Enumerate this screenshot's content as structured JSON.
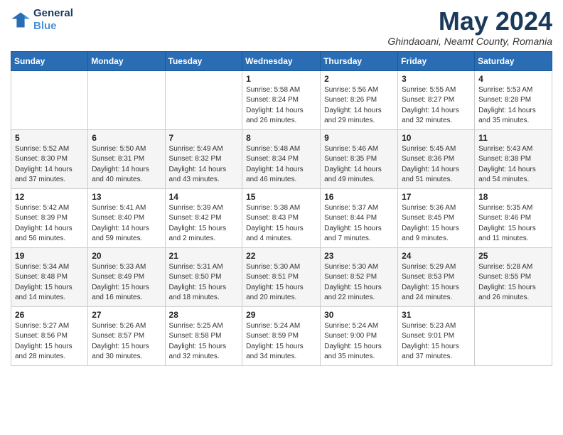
{
  "header": {
    "logo_line1": "General",
    "logo_line2": "Blue",
    "month_title": "May 2024",
    "location": "Ghindaoani, Neamt County, Romania"
  },
  "weekdays": [
    "Sunday",
    "Monday",
    "Tuesday",
    "Wednesday",
    "Thursday",
    "Friday",
    "Saturday"
  ],
  "weeks": [
    [
      {
        "day": "",
        "info": ""
      },
      {
        "day": "",
        "info": ""
      },
      {
        "day": "",
        "info": ""
      },
      {
        "day": "1",
        "info": "Sunrise: 5:58 AM\nSunset: 8:24 PM\nDaylight: 14 hours\nand 26 minutes."
      },
      {
        "day": "2",
        "info": "Sunrise: 5:56 AM\nSunset: 8:26 PM\nDaylight: 14 hours\nand 29 minutes."
      },
      {
        "day": "3",
        "info": "Sunrise: 5:55 AM\nSunset: 8:27 PM\nDaylight: 14 hours\nand 32 minutes."
      },
      {
        "day": "4",
        "info": "Sunrise: 5:53 AM\nSunset: 8:28 PM\nDaylight: 14 hours\nand 35 minutes."
      }
    ],
    [
      {
        "day": "5",
        "info": "Sunrise: 5:52 AM\nSunset: 8:30 PM\nDaylight: 14 hours\nand 37 minutes."
      },
      {
        "day": "6",
        "info": "Sunrise: 5:50 AM\nSunset: 8:31 PM\nDaylight: 14 hours\nand 40 minutes."
      },
      {
        "day": "7",
        "info": "Sunrise: 5:49 AM\nSunset: 8:32 PM\nDaylight: 14 hours\nand 43 minutes."
      },
      {
        "day": "8",
        "info": "Sunrise: 5:48 AM\nSunset: 8:34 PM\nDaylight: 14 hours\nand 46 minutes."
      },
      {
        "day": "9",
        "info": "Sunrise: 5:46 AM\nSunset: 8:35 PM\nDaylight: 14 hours\nand 49 minutes."
      },
      {
        "day": "10",
        "info": "Sunrise: 5:45 AM\nSunset: 8:36 PM\nDaylight: 14 hours\nand 51 minutes."
      },
      {
        "day": "11",
        "info": "Sunrise: 5:43 AM\nSunset: 8:38 PM\nDaylight: 14 hours\nand 54 minutes."
      }
    ],
    [
      {
        "day": "12",
        "info": "Sunrise: 5:42 AM\nSunset: 8:39 PM\nDaylight: 14 hours\nand 56 minutes."
      },
      {
        "day": "13",
        "info": "Sunrise: 5:41 AM\nSunset: 8:40 PM\nDaylight: 14 hours\nand 59 minutes."
      },
      {
        "day": "14",
        "info": "Sunrise: 5:39 AM\nSunset: 8:42 PM\nDaylight: 15 hours\nand 2 minutes."
      },
      {
        "day": "15",
        "info": "Sunrise: 5:38 AM\nSunset: 8:43 PM\nDaylight: 15 hours\nand 4 minutes."
      },
      {
        "day": "16",
        "info": "Sunrise: 5:37 AM\nSunset: 8:44 PM\nDaylight: 15 hours\nand 7 minutes."
      },
      {
        "day": "17",
        "info": "Sunrise: 5:36 AM\nSunset: 8:45 PM\nDaylight: 15 hours\nand 9 minutes."
      },
      {
        "day": "18",
        "info": "Sunrise: 5:35 AM\nSunset: 8:46 PM\nDaylight: 15 hours\nand 11 minutes."
      }
    ],
    [
      {
        "day": "19",
        "info": "Sunrise: 5:34 AM\nSunset: 8:48 PM\nDaylight: 15 hours\nand 14 minutes."
      },
      {
        "day": "20",
        "info": "Sunrise: 5:33 AM\nSunset: 8:49 PM\nDaylight: 15 hours\nand 16 minutes."
      },
      {
        "day": "21",
        "info": "Sunrise: 5:31 AM\nSunset: 8:50 PM\nDaylight: 15 hours\nand 18 minutes."
      },
      {
        "day": "22",
        "info": "Sunrise: 5:30 AM\nSunset: 8:51 PM\nDaylight: 15 hours\nand 20 minutes."
      },
      {
        "day": "23",
        "info": "Sunrise: 5:30 AM\nSunset: 8:52 PM\nDaylight: 15 hours\nand 22 minutes."
      },
      {
        "day": "24",
        "info": "Sunrise: 5:29 AM\nSunset: 8:53 PM\nDaylight: 15 hours\nand 24 minutes."
      },
      {
        "day": "25",
        "info": "Sunrise: 5:28 AM\nSunset: 8:55 PM\nDaylight: 15 hours\nand 26 minutes."
      }
    ],
    [
      {
        "day": "26",
        "info": "Sunrise: 5:27 AM\nSunset: 8:56 PM\nDaylight: 15 hours\nand 28 minutes."
      },
      {
        "day": "27",
        "info": "Sunrise: 5:26 AM\nSunset: 8:57 PM\nDaylight: 15 hours\nand 30 minutes."
      },
      {
        "day": "28",
        "info": "Sunrise: 5:25 AM\nSunset: 8:58 PM\nDaylight: 15 hours\nand 32 minutes."
      },
      {
        "day": "29",
        "info": "Sunrise: 5:24 AM\nSunset: 8:59 PM\nDaylight: 15 hours\nand 34 minutes."
      },
      {
        "day": "30",
        "info": "Sunrise: 5:24 AM\nSunset: 9:00 PM\nDaylight: 15 hours\nand 35 minutes."
      },
      {
        "day": "31",
        "info": "Sunrise: 5:23 AM\nSunset: 9:01 PM\nDaylight: 15 hours\nand 37 minutes."
      },
      {
        "day": "",
        "info": ""
      }
    ]
  ]
}
